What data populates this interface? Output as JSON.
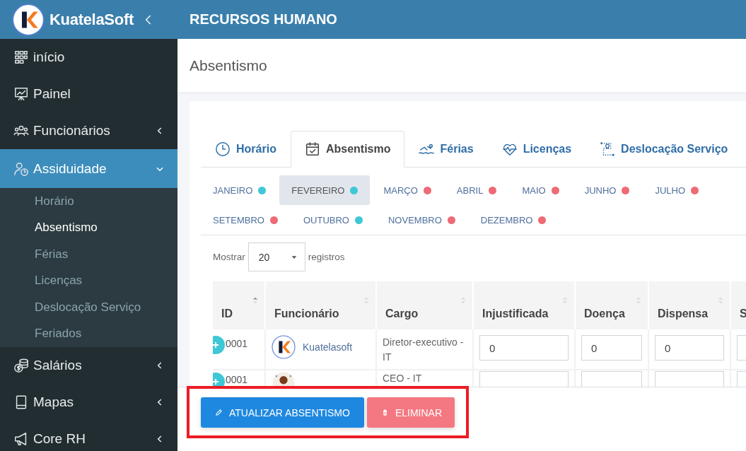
{
  "brand": {
    "name": "KuatelaSoft"
  },
  "header": {
    "title": "RECURSOS HUMANO"
  },
  "sidebar": {
    "items": [
      {
        "label": "início",
        "kind": "link",
        "selected": false
      },
      {
        "label": "Painel",
        "kind": "link",
        "selected": false
      },
      {
        "label": "Funcionários",
        "kind": "group",
        "selected": false,
        "expanded": false
      },
      {
        "label": "Assiduidade",
        "kind": "group",
        "selected": true,
        "expanded": true,
        "children": [
          {
            "label": "Horário",
            "selected": false
          },
          {
            "label": "Absentismo",
            "selected": true
          },
          {
            "label": "Férias",
            "selected": false
          },
          {
            "label": "Licenças",
            "selected": false
          },
          {
            "label": "Deslocação Serviço",
            "selected": false
          },
          {
            "label": "Feriados",
            "selected": false
          }
        ]
      },
      {
        "label": "Salários",
        "kind": "group",
        "selected": false,
        "expanded": false
      },
      {
        "label": "Mapas",
        "kind": "group",
        "selected": false,
        "expanded": false
      },
      {
        "label": "Core RH",
        "kind": "group",
        "selected": false,
        "expanded": false
      }
    ]
  },
  "page": {
    "title": "Absentismo"
  },
  "tabs": [
    {
      "label": "Horário",
      "selected": false
    },
    {
      "label": "Absentismo",
      "selected": true
    },
    {
      "label": "Férias",
      "selected": false
    },
    {
      "label": "Licenças",
      "selected": false
    },
    {
      "label": "Deslocação Serviço",
      "selected": false
    }
  ],
  "months": [
    {
      "label": "JANEIRO",
      "color": "#3ec7d6",
      "selected": false
    },
    {
      "label": "FEVEREIRO",
      "color": "#3ec7d6",
      "selected": true
    },
    {
      "label": "MARÇO",
      "color": "#ee6a75",
      "selected": false
    },
    {
      "label": "ABRIL",
      "color": "#ee6a75",
      "selected": false
    },
    {
      "label": "MAIO",
      "color": "#ee6a75",
      "selected": false
    },
    {
      "label": "JUNHO",
      "color": "#ee6a75",
      "selected": false
    },
    {
      "label": "JULHO",
      "color": "#ee6a75",
      "selected": false
    },
    {
      "label": "SETEMBRO",
      "color": "#ee6a75",
      "selected": false
    },
    {
      "label": "OUTUBRO",
      "color": "#3ec7d6",
      "selected": false
    },
    {
      "label": "NOVEMBRO",
      "color": "#ee6a75",
      "selected": false
    },
    {
      "label": "DEZEMBRO",
      "color": "#ee6a75",
      "selected": false
    }
  ],
  "page_length": {
    "label_before": "Mostrar",
    "value": "20",
    "label_after": "registros"
  },
  "table": {
    "columns": [
      {
        "label": "ID",
        "sorted": true
      },
      {
        "label": "Funcionário",
        "sorted": false
      },
      {
        "label": "Cargo",
        "sorted": false
      },
      {
        "label": "Injustificada",
        "sorted": false
      },
      {
        "label": "Doença",
        "sorted": false
      },
      {
        "label": "Dispensa",
        "sorted": false
      },
      {
        "label": "S"
      }
    ],
    "rows": [
      {
        "id": "0001",
        "name": "Kuatelasoft",
        "cargo": "Diretor-executivo - IT",
        "values": [
          "0",
          "0",
          "0"
        ]
      },
      {
        "id": "0001",
        "cargo": "CEO - IT"
      }
    ]
  },
  "actions": {
    "highlighted": true,
    "buttons": [
      {
        "label": "ATUALIZAR ABSENTISMO",
        "kind": "primary"
      },
      {
        "label": "ELIMINAR",
        "kind": "danger"
      }
    ]
  }
}
